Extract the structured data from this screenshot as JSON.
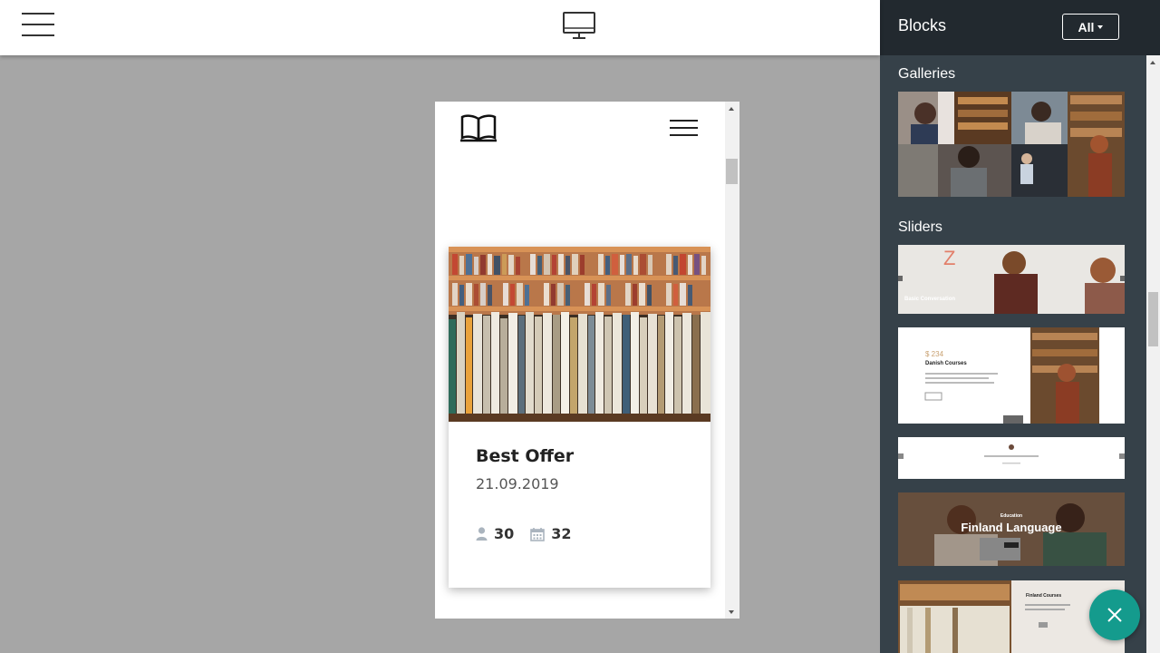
{
  "topbar": {
    "menu_icon": "hamburger-menu-icon",
    "device_icon": "desktop-monitor-icon"
  },
  "preview": {
    "logo_icon": "open-book-icon",
    "menu_icon": "hamburger-menu-icon",
    "card": {
      "title": "Best Offer",
      "date": "21.09.2019",
      "stats": [
        {
          "icon": "user-icon",
          "value": "30"
        },
        {
          "icon": "calendar-icon",
          "value": "32"
        }
      ]
    }
  },
  "panel": {
    "title": "Blocks",
    "filter_label": "All",
    "sections": [
      {
        "label": "Galleries"
      },
      {
        "label": "Sliders"
      }
    ],
    "slider_thumbs": {
      "s1_caption": "Basic Conversation",
      "s2_price": "$ 234",
      "s2_title": "Danish Courses",
      "s4_kicker": "Education",
      "s4_title": "Finland Language",
      "s5_title": "Finland Courses"
    }
  },
  "fab": {
    "icon": "close-icon"
  },
  "colors": {
    "panel_bg": "#364149",
    "panel_header": "#22292f",
    "fab": "#149b8d",
    "canvas": "#a6a6a6"
  }
}
